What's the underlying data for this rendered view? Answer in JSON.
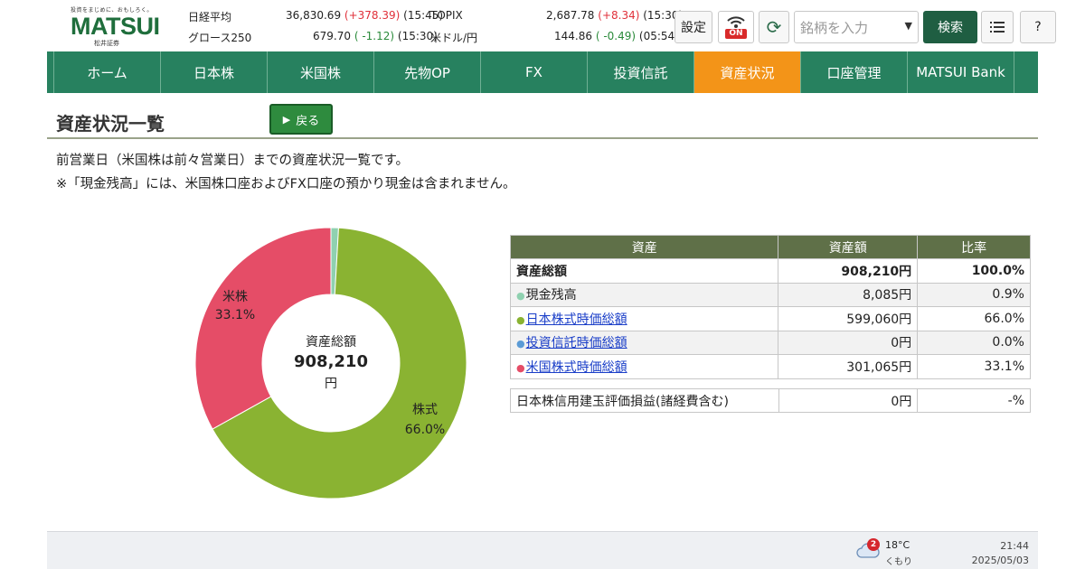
{
  "logo": {
    "tagline": "投資をまじめに、おもしろく。",
    "brand": "MATSUI",
    "subtitle": "松井証券"
  },
  "market": {
    "nikkei": {
      "name": "日経平均",
      "value": "36,830.69",
      "change": "(+378.39)",
      "time": "(15:45)"
    },
    "topix": {
      "name": "TOPIX",
      "value": "2,687.78",
      "change": "(+8.34)",
      "time": "(15:30)"
    },
    "growth": {
      "name": "グロース250",
      "value": "679.70",
      "change": "( -1.12)",
      "time": "(15:30)"
    },
    "usdjpy": {
      "name": "米ドル/円",
      "value": "144.86",
      "change": "( -0.49)",
      "time": "(05:54)"
    },
    "colors": {
      "up": "#e0303a",
      "down": "#2a8a3a"
    }
  },
  "header": {
    "settings_label": "設定",
    "wifi_status": "ON",
    "search_placeholder": "銘柄を入力",
    "search_button": "検索",
    "help_label": "?"
  },
  "nav": {
    "items": [
      "ホーム",
      "日本株",
      "米国株",
      "先物OP",
      "FX",
      "投資信託",
      "資産状況",
      "口座管理",
      "MATSUI Bank"
    ],
    "active": "資産状況",
    "colors": {
      "bar": "#27815f",
      "active": "#f39418"
    }
  },
  "page": {
    "title": "資産状況一覧",
    "back_label": "戻る",
    "desc1": "前営業日（米国株は前々営業日）までの資産状況一覧です。",
    "desc2": "※「現金残高」には、米国株口座およびFX口座の預かり現金は含まれません。"
  },
  "chart_data": {
    "type": "pie",
    "style": "donut",
    "slices": [
      {
        "name": "現金残高",
        "value": 0.9,
        "color": "#8fd1b0"
      },
      {
        "name": "株式",
        "value": 66.0,
        "color": "#8ab332",
        "label": "株式",
        "label_pct": "66.0%"
      },
      {
        "name": "投資信託",
        "value": 0.0,
        "color": "#5b9bd5"
      },
      {
        "name": "米株",
        "value": 33.1,
        "color": "#e54d67",
        "label": "米株",
        "label_pct": "33.1%"
      }
    ],
    "center": {
      "title": "資産総額",
      "value": "908,210",
      "unit": "円"
    }
  },
  "table": {
    "headers": [
      "資産",
      "資産額",
      "比率"
    ],
    "total": {
      "name": "資産総額",
      "amount": "908,210円",
      "ratio": "100.0%"
    },
    "rows": [
      {
        "dot_color": "#8fd1b0",
        "name": "現金残高",
        "amount": "8,085円",
        "ratio": "0.9%",
        "link": false
      },
      {
        "dot_color": "#8ab332",
        "name": "日本株式時価総額",
        "amount": "599,060円",
        "ratio": "66.0%",
        "link": true
      },
      {
        "dot_color": "#5b9bd5",
        "name": "投資信託時価総額",
        "amount": "0円",
        "ratio": "0.0%",
        "link": true
      },
      {
        "dot_color": "#e54d67",
        "name": "米国株式時価総額",
        "amount": "301,065円",
        "ratio": "33.1%",
        "link": true
      }
    ],
    "margin": {
      "name": "日本株信用建玉評価損益(諸経費含む)",
      "amount": "0円",
      "ratio": "-%"
    }
  },
  "taskbar": {
    "weather_badge": "2",
    "temperature": "18°C",
    "condition": "くもり",
    "time": "21:44",
    "date": "2025/05/03"
  }
}
